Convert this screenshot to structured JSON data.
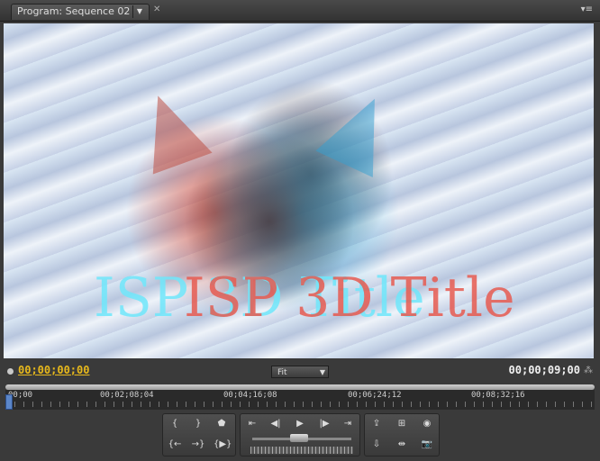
{
  "panel": {
    "tab_title": "Program: Sequence 02",
    "tab_menu_icon": "chevron-down-icon",
    "close_icon": "close-icon",
    "panel_menu_icon": "panel-menu-icon"
  },
  "video": {
    "title_cyan": "ISP 3D Title",
    "title_red": "ISP 3D Title"
  },
  "controls": {
    "current_timecode": "00;00;00;00",
    "zoom_value": "Fit",
    "duration_timecode": "00;00;09;00"
  },
  "ruler": {
    "labels": [
      "00;00",
      "00;02;08;04",
      "00;04;16;08",
      "00;06;24;12",
      "00;08;32;16"
    ]
  },
  "buttons": {
    "mark_in": "mark-in-icon",
    "mark_out": "mark-out-icon",
    "set_marker": "marker-icon",
    "go_to_in": "go-to-in-icon",
    "go_to_out": "go-to-out-icon",
    "play_in_to_out": "play-in-to-out-icon",
    "go_prev_edit": "go-to-previous-edit-icon",
    "step_back": "step-back-icon",
    "play": "play-icon",
    "step_forward": "step-forward-icon",
    "go_next_edit": "go-to-next-edit-icon",
    "lift": "lift-icon",
    "extract": "extract-icon",
    "trim_monitor": "trim-icon",
    "safe_margins": "safe-margins-icon",
    "output": "output-icon",
    "export_frame": "camera-icon"
  }
}
